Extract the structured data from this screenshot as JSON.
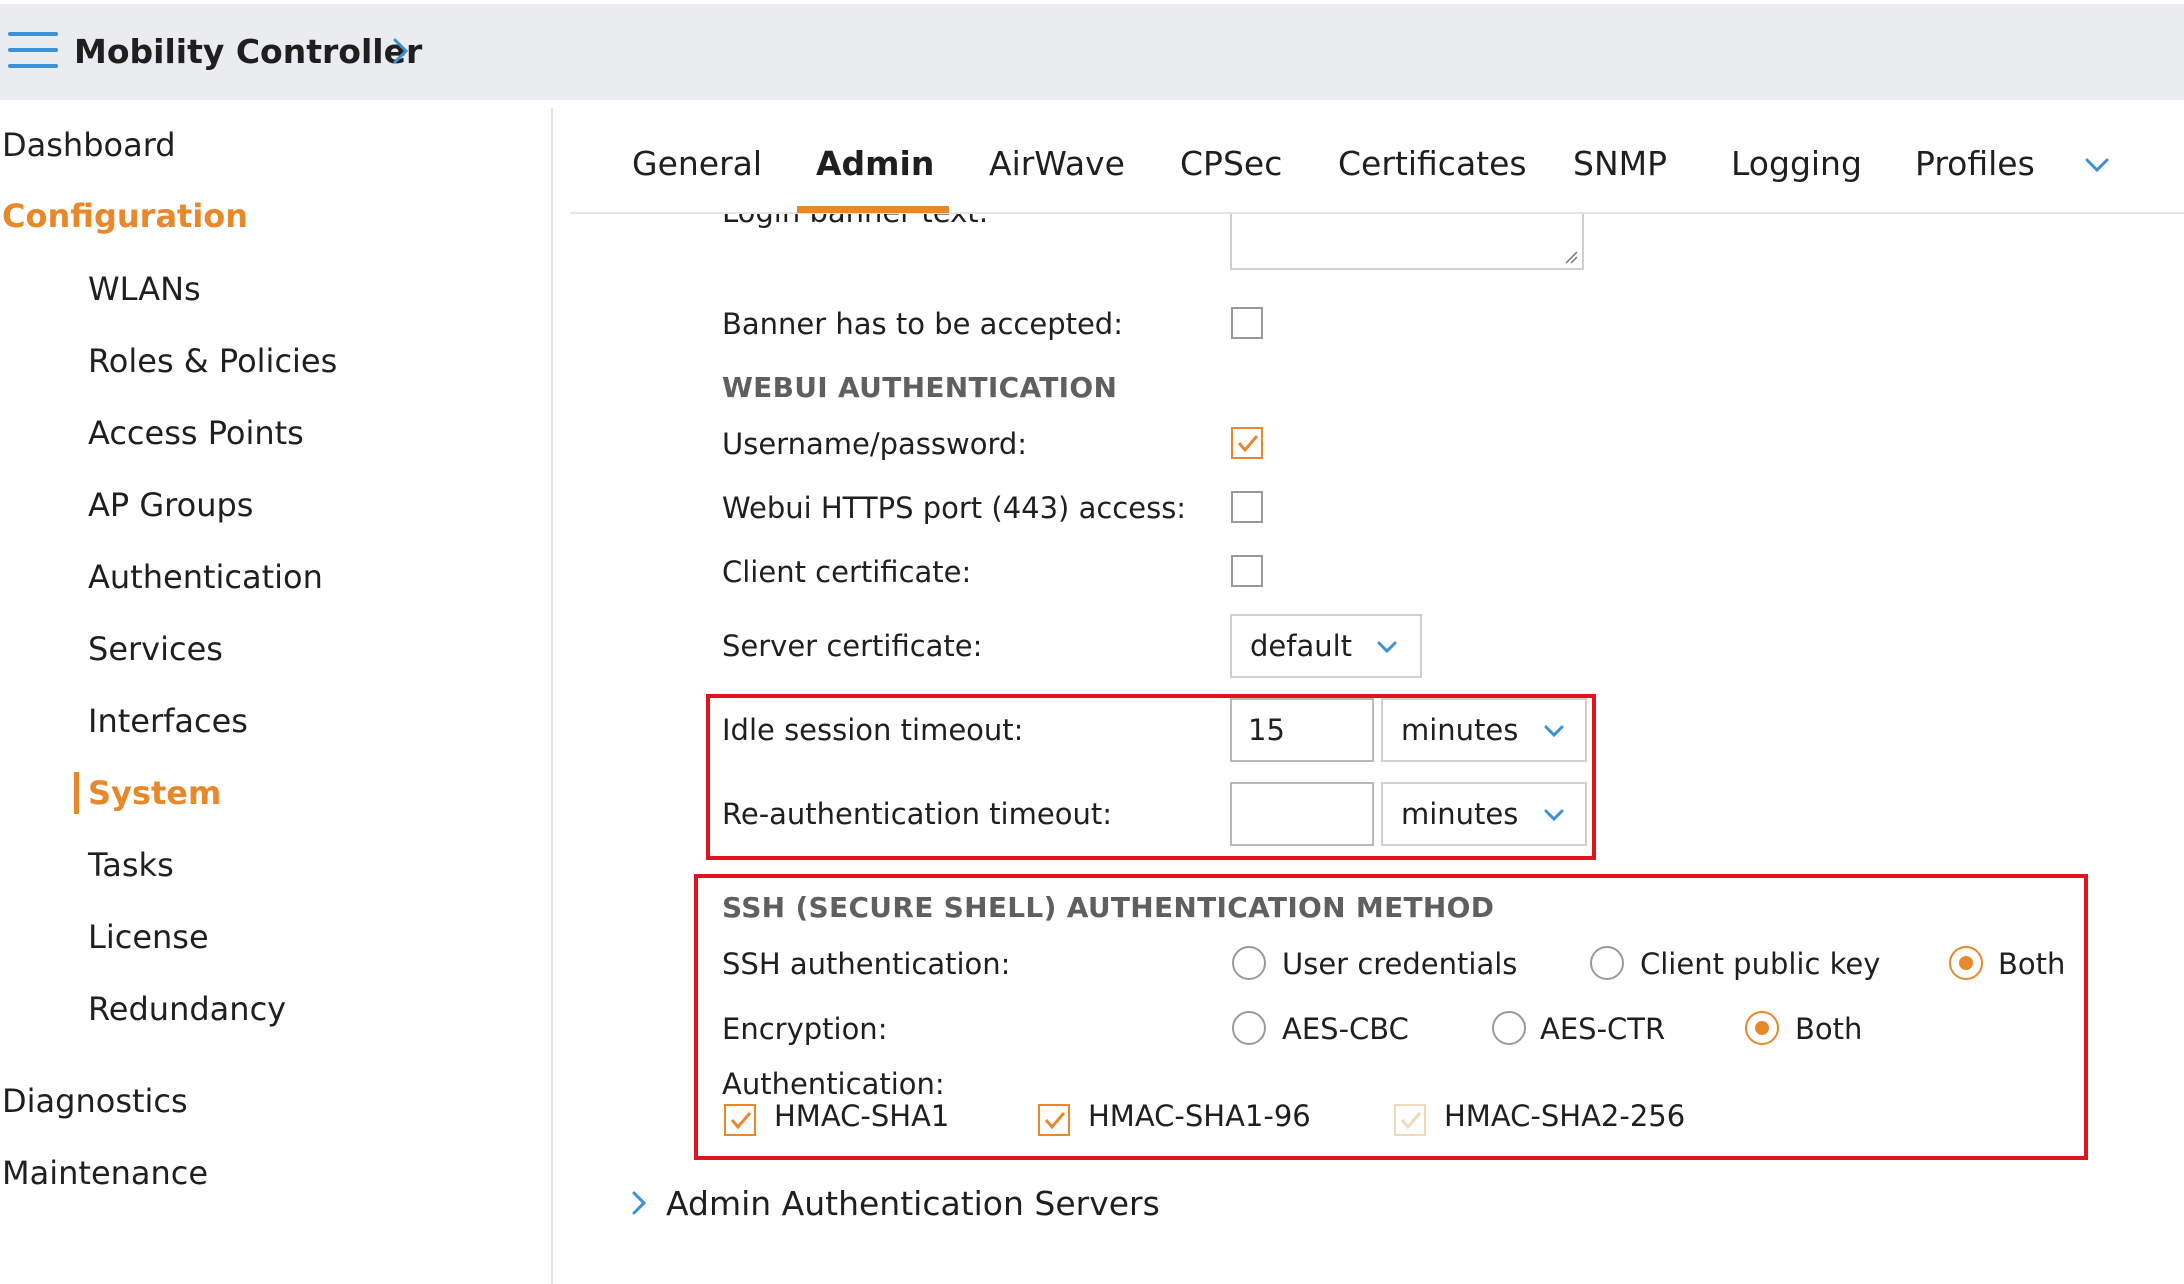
{
  "header": {
    "title": "Mobility Controller"
  },
  "sidebar": {
    "top": [
      {
        "label": "Dashboard",
        "active": false
      },
      {
        "label": "Configuration",
        "active": true
      },
      {
        "label": "Diagnostics",
        "active": false
      },
      {
        "label": "Maintenance",
        "active": false
      }
    ],
    "config_items": [
      {
        "label": "WLANs"
      },
      {
        "label": "Roles & Policies"
      },
      {
        "label": "Access Points"
      },
      {
        "label": "AP Groups"
      },
      {
        "label": "Authentication"
      },
      {
        "label": "Services"
      },
      {
        "label": "Interfaces"
      },
      {
        "label": "System",
        "active": true
      },
      {
        "label": "Tasks"
      },
      {
        "label": "License"
      },
      {
        "label": "Redundancy"
      }
    ]
  },
  "tabs": [
    {
      "label": "General"
    },
    {
      "label": "Admin",
      "active": true
    },
    {
      "label": "AirWave"
    },
    {
      "label": "CPSec"
    },
    {
      "label": "Certificates"
    },
    {
      "label": "SNMP"
    },
    {
      "label": "Logging"
    },
    {
      "label": "Profiles"
    }
  ],
  "form": {
    "login_banner_label": "Login banner text:",
    "banner_accepted": {
      "label": "Banner has to be accepted:",
      "checked": false
    },
    "webui_section": "WEBUI AUTHENTICATION",
    "username_password": {
      "label": "Username/password:",
      "checked": true
    },
    "https_port": {
      "label": "Webui HTTPS port (443) access:",
      "checked": false
    },
    "client_cert": {
      "label": "Client certificate:",
      "checked": false
    },
    "server_cert": {
      "label": "Server certificate:",
      "value": "default"
    },
    "idle_timeout": {
      "label": "Idle session timeout:",
      "value": "15",
      "unit": "minutes"
    },
    "reauth_timeout": {
      "label": "Re-authentication timeout:",
      "value": "",
      "unit": "minutes"
    },
    "ssh_section": "SSH (SECURE SHELL) AUTHENTICATION METHOD",
    "ssh_auth": {
      "label": "SSH authentication:",
      "options": [
        "User credentials",
        "Client public key",
        "Both"
      ],
      "selected": "Both"
    },
    "encryption": {
      "label": "Encryption:",
      "options": [
        "AES-CBC",
        "AES-CTR",
        "Both"
      ],
      "selected": "Both"
    },
    "authentication": {
      "label": "Authentication:",
      "options": [
        {
          "label": "HMAC-SHA1",
          "checked": true
        },
        {
          "label": "HMAC-SHA1-96",
          "checked": true
        },
        {
          "label": "HMAC-SHA2-256",
          "checked": true,
          "disabled": true
        }
      ]
    }
  },
  "footer": {
    "expander_label": "Admin Authentication Servers"
  },
  "colors": {
    "accent": "#e8882b",
    "link_blue": "#3d8fd6",
    "highlight_red": "#e0141e",
    "header_bg": "#ebecf0"
  }
}
